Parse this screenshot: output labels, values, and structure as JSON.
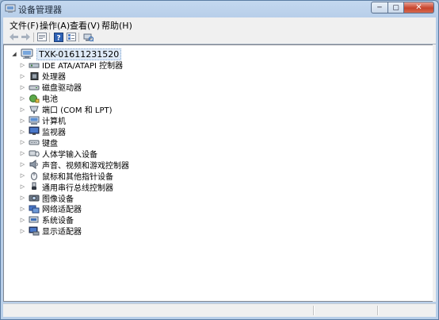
{
  "window": {
    "title": "设备管理器",
    "buttons": {
      "minimize": "─",
      "maximize": "▢",
      "close": "✕"
    }
  },
  "menu": [
    {
      "label": "文件(F)"
    },
    {
      "label": "操作(A)"
    },
    {
      "label": "查看(V)"
    },
    {
      "label": "帮助(H)"
    }
  ],
  "toolbar": {
    "icons": [
      "back-arrow-icon",
      "forward-arrow-icon",
      "properties-icon",
      "help-icon",
      "view-icon",
      "scan-hardware-icon"
    ]
  },
  "tree": {
    "root": {
      "label": "TXK-01611231520",
      "expander": "◢",
      "icon": "computer-icon"
    },
    "expander_collapsed": "▷",
    "items": [
      {
        "label": "IDE ATA/ATAPI 控制器",
        "icon": "ide-controller-icon"
      },
      {
        "label": "处理器",
        "icon": "processor-icon"
      },
      {
        "label": "磁盘驱动器",
        "icon": "disk-drive-icon"
      },
      {
        "label": "电池",
        "icon": "battery-icon"
      },
      {
        "label": "端口 (COM 和 LPT)",
        "icon": "port-icon"
      },
      {
        "label": "计算机",
        "icon": "computer-icon"
      },
      {
        "label": "监视器",
        "icon": "monitor-icon"
      },
      {
        "label": "键盘",
        "icon": "keyboard-icon"
      },
      {
        "label": "人体学输入设备",
        "icon": "hid-icon"
      },
      {
        "label": "声音、视频和游戏控制器",
        "icon": "sound-icon"
      },
      {
        "label": "鼠标和其他指针设备",
        "icon": "mouse-icon"
      },
      {
        "label": "通用串行总线控制器",
        "icon": "usb-icon"
      },
      {
        "label": "图像设备",
        "icon": "imaging-device-icon"
      },
      {
        "label": "网络适配器",
        "icon": "network-adapter-icon"
      },
      {
        "label": "系统设备",
        "icon": "system-device-icon"
      },
      {
        "label": "显示适配器",
        "icon": "display-adapter-icon"
      }
    ]
  },
  "colors": {
    "title_bar": "#b3cbe7",
    "selection": "#dfeaf7",
    "close_button": "#c7442c"
  }
}
